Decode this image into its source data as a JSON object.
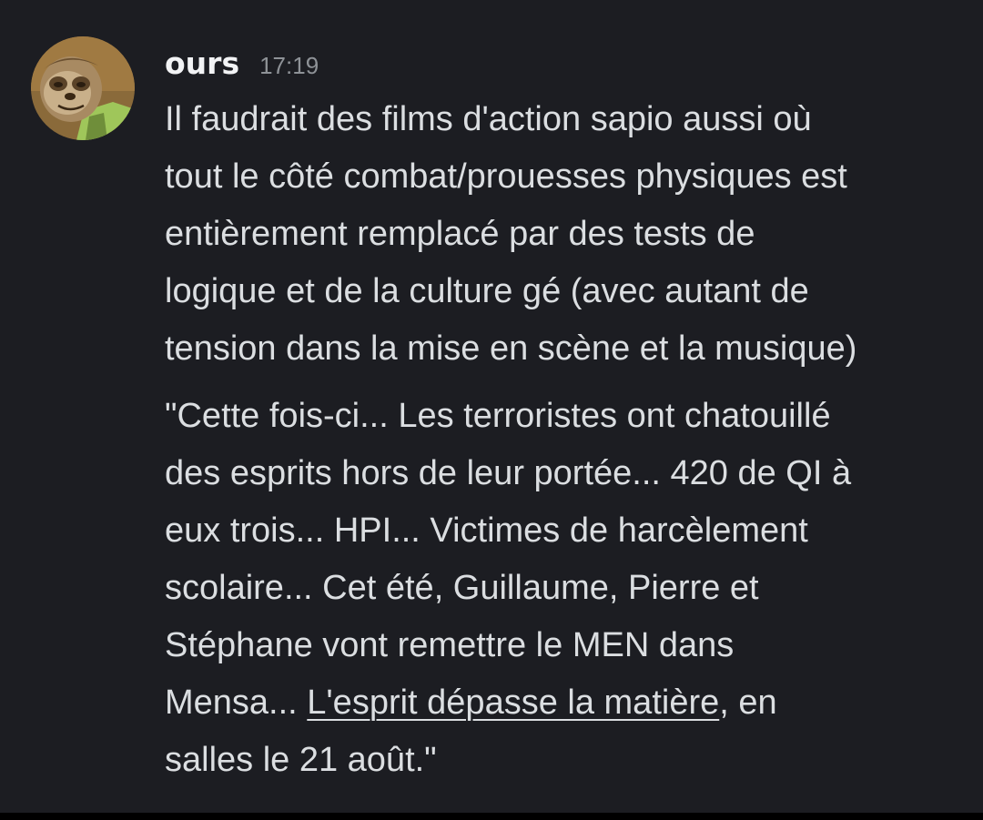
{
  "message": {
    "username": "ours",
    "timestamp": "17:19",
    "avatar_icon": "sloth-avatar",
    "paragraph1_lines": [
      "Il faudrait des films d'action sapio aussi où",
      "tout le côté combat/prouesses physiques est",
      "entièrement remplacé par des tests de",
      "logique et de la culture gé (avec autant de",
      "tension dans la mise en scène et la musique)"
    ],
    "paragraph2_lines": [
      "\"Cette fois-ci... Les terroristes ont chatouillé",
      "des esprits hors de leur portée... 420 de QI à",
      "eux trois... HPI... Victimes de harcèlement",
      "scolaire... Cet été, Guillaume, Pierre et",
      "Stéphane vont remettre le MEN dans"
    ],
    "paragraph2_line6_before": "Mensa... ",
    "paragraph2_link": "L'esprit dépasse la matière",
    "paragraph2_line6_after": ", en",
    "paragraph2_line7": "salles le 21 août.\""
  },
  "colors": {
    "background": "#1c1d22",
    "text": "#dbdee1",
    "username": "#f2f3f5",
    "timestamp": "#8e9297"
  }
}
